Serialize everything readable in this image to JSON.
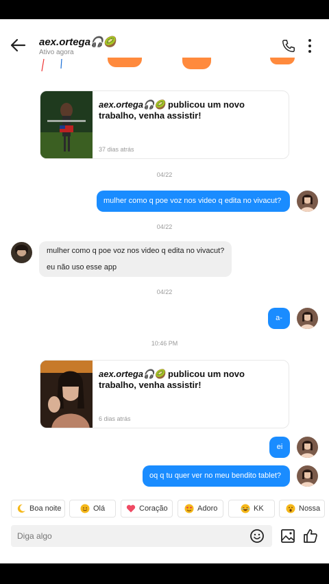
{
  "header": {
    "username": "aex.ortega🎧🥝",
    "status": "Ativo agora"
  },
  "messages": {
    "card1": {
      "name": "aex.ortega🎧🥝",
      "text": " publicou um novo trabalho, venha assistir!",
      "time": "37 dias atrás"
    },
    "date1": "04/22",
    "out1": "mulher como q poe voz nos video q edita no vivacut?",
    "date2": "04/22",
    "in1_line1": "mulher como q poe voz nos video q edita no vivacut?",
    "in1_line2": "eu não uso esse app",
    "date3": "04/22",
    "out2": "a-",
    "date4": "10:46 PM",
    "card2": {
      "name": "aex.ortega🎧🥝",
      "text": " publicou um novo trabalho, venha assistir!",
      "time": "6 dias atrás"
    },
    "out3": "ei",
    "out4": "oq q tu quer ver no meu bendito tablet?"
  },
  "quick_replies": [
    {
      "label": "Boa noite",
      "icon": "crescent-moon-icon"
    },
    {
      "label": "Olá",
      "icon": "smile-face-icon"
    },
    {
      "label": "Coração",
      "icon": "heart-icon"
    },
    {
      "label": "Adoro",
      "icon": "heart-eyes-icon"
    },
    {
      "label": "KK",
      "icon": "laughing-face-icon"
    },
    {
      "label": "Nossa",
      "icon": "surprised-face-icon"
    }
  ],
  "composer": {
    "placeholder": "Diga algo"
  },
  "colors": {
    "accent": "#1a8cff",
    "incoming": "#efefef",
    "peek_orange": "#ff8a3d"
  }
}
